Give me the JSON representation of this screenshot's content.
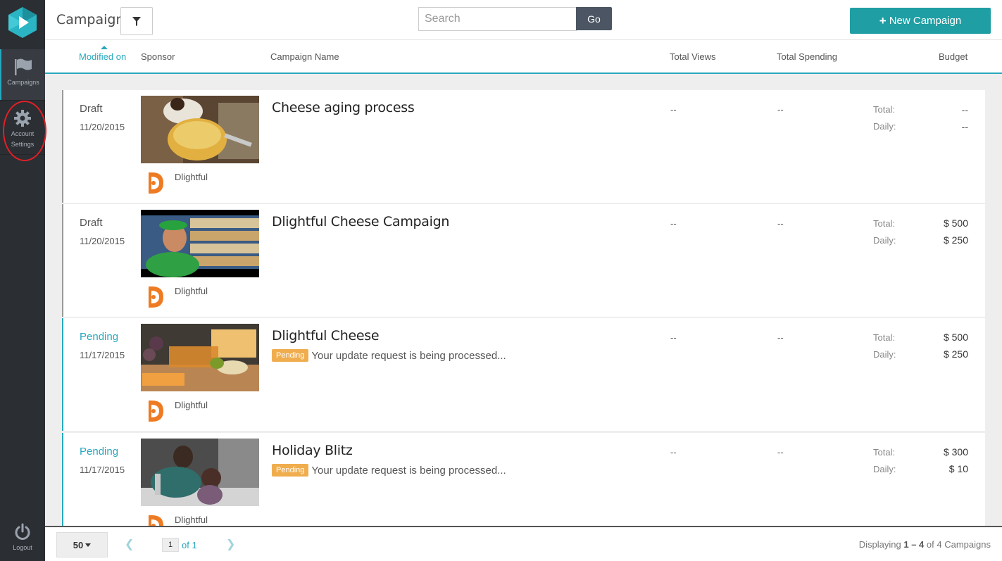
{
  "sidebar": {
    "items": [
      {
        "label": "Campaigns",
        "icon": "flag-icon"
      },
      {
        "label": "Account Settings",
        "icon": "gear-icon"
      },
      {
        "label": "Logout",
        "icon": "power-icon"
      }
    ]
  },
  "header": {
    "title": "Campaigns",
    "search_placeholder": "Search",
    "go_label": "Go",
    "new_campaign_label": "New Campaign",
    "accent_color": "#1f9ea3"
  },
  "columns": {
    "modified_on": "Modified on",
    "sponsor": "Sponsor",
    "campaign_name": "Campaign Name",
    "total_views": "Total Views",
    "total_spending": "Total Spending",
    "budget": "Budget"
  },
  "campaigns": [
    {
      "status": "Draft",
      "date": "11/20/2015",
      "sponsor": "Dlightful",
      "name": "Cheese aging process",
      "pending_badge": "",
      "pending_message": "",
      "views": "--",
      "spending": "--",
      "total_label": "Total:",
      "daily_label": "Daily:",
      "total": "--",
      "daily": "--"
    },
    {
      "status": "Draft",
      "date": "11/20/2015",
      "sponsor": "Dlightful",
      "name": "Dlightful Cheese Campaign",
      "pending_badge": "",
      "pending_message": "",
      "views": "--",
      "spending": "--",
      "total_label": "Total:",
      "daily_label": "Daily:",
      "total": "$ 500",
      "daily": "$ 250"
    },
    {
      "status": "Pending",
      "date": "11/17/2015",
      "sponsor": "Dlightful",
      "name": "Dlightful Cheese",
      "pending_badge": "Pending",
      "pending_message": "Your update request is being processed...",
      "views": "--",
      "spending": "--",
      "total_label": "Total:",
      "daily_label": "Daily:",
      "total": "$ 500",
      "daily": "$ 250"
    },
    {
      "status": "Pending",
      "date": "11/17/2015",
      "sponsor": "Dlightful",
      "name": "Holiday Blitz",
      "pending_badge": "Pending",
      "pending_message": "Your update request is being processed...",
      "views": "--",
      "spending": "--",
      "total_label": "Total:",
      "daily_label": "Daily:",
      "total": "$ 300",
      "daily": "$ 10"
    }
  ],
  "footer": {
    "per_page": "50",
    "current_page": "1",
    "of_pages": "of 1",
    "display_prefix": "Displaying",
    "display_range": "1 – 4",
    "display_of": "of",
    "display_total": "4 Campaigns"
  }
}
